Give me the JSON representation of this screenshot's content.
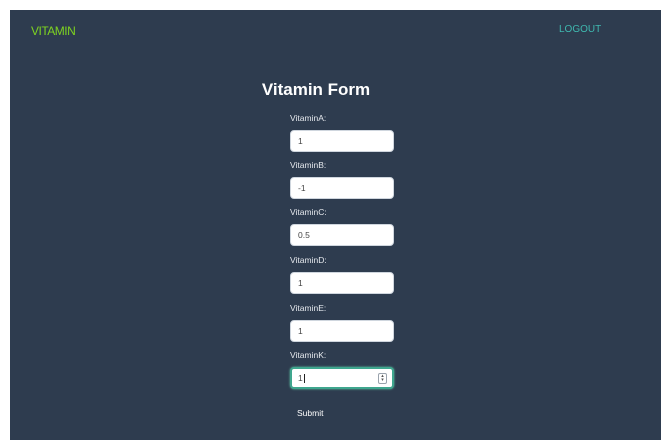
{
  "nav": {
    "brand": "VITAMIN",
    "logout_label": "LOGOUT"
  },
  "form": {
    "title": "Vitamin Form",
    "fields": [
      {
        "label": "VitaminA:",
        "value": "1"
      },
      {
        "label": "VitaminB:",
        "value": "-1"
      },
      {
        "label": "VitaminC:",
        "value": "0.5"
      },
      {
        "label": "VitaminD:",
        "value": "1"
      },
      {
        "label": "VitaminE:",
        "value": "1"
      },
      {
        "label": "VitaminK:",
        "value": "1"
      }
    ],
    "submit_label": "Submit"
  },
  "colors": {
    "background": "#2e3c4f",
    "brand": "#7ed321",
    "logout": "#3fb8af",
    "focus_border": "#3fa68e"
  },
  "icons": {
    "stepper": "number-stepper-icon"
  }
}
